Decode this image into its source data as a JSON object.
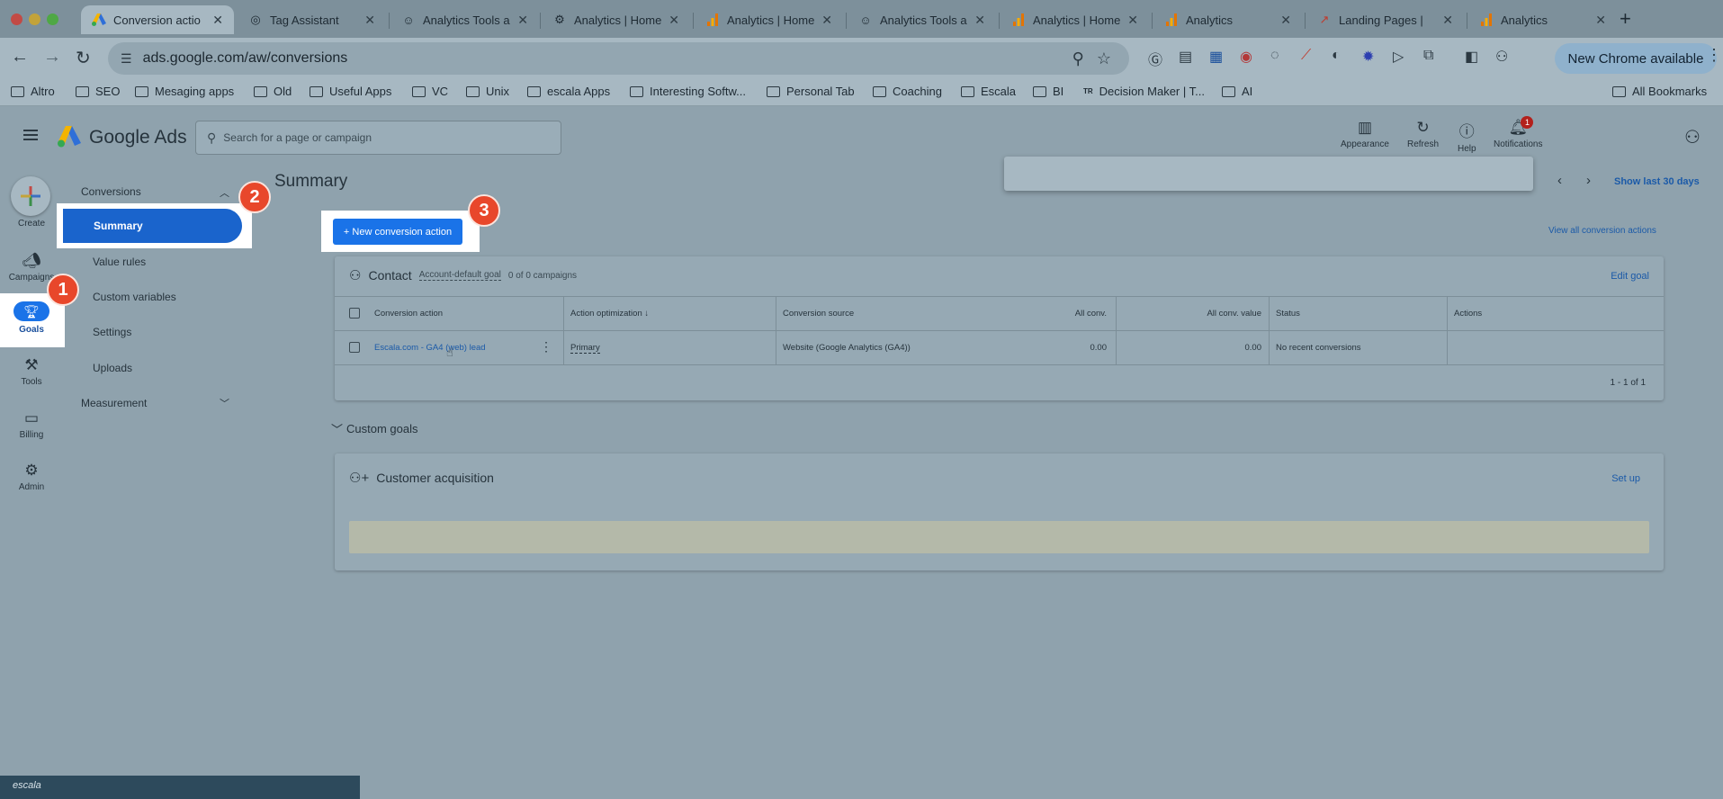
{
  "browser": {
    "tabs": [
      {
        "title": "Conversion actio",
        "icon": "google-ads-icon",
        "active": true
      },
      {
        "title": "Tag Assistant",
        "icon": "tag-assistant-icon"
      },
      {
        "title": "Analytics Tools a",
        "icon": "smiley-icon"
      },
      {
        "title": "Analytics | Home",
        "icon": "settings-gear-icon"
      },
      {
        "title": "Analytics | Home",
        "icon": "analytics-icon"
      },
      {
        "title": "Analytics Tools a",
        "icon": "smiley-icon"
      },
      {
        "title": "Analytics | Home",
        "icon": "analytics-icon"
      },
      {
        "title": "Analytics",
        "icon": "analytics-icon"
      },
      {
        "title": "Landing Pages |",
        "icon": "landing-pages-icon"
      },
      {
        "title": "Analytics",
        "icon": "analytics-icon"
      }
    ],
    "url": "ads.google.com/aw/conversions",
    "new_chrome_label": "New Chrome available",
    "bookmarks": [
      "Altro",
      "SEO",
      "Mesaging apps",
      "Old",
      "Useful Apps",
      "VC",
      "Unix",
      "escala Apps",
      "Interesting Softw...",
      "Personal Tab",
      "Coaching",
      "Escala",
      "BI",
      "Decision Maker | T...",
      "AI"
    ],
    "all_bookmarks_label": "All Bookmarks"
  },
  "ads": {
    "brand": "Google Ads",
    "search_placeholder": "Search for a page or campaign",
    "header_tools": [
      {
        "label": "Appearance",
        "icon": "appearance-icon"
      },
      {
        "label": "Refresh",
        "icon": "refresh-icon"
      },
      {
        "label": "Help",
        "icon": "help-icon"
      },
      {
        "label": "Notifications",
        "icon": "bell-icon",
        "badge": "1"
      }
    ],
    "rail": {
      "create": "Create",
      "campaigns": "Campaigns",
      "goals": "Goals",
      "tools": "Tools",
      "billing": "Billing",
      "admin": "Admin"
    },
    "subnav": {
      "conversions": "Conversions",
      "summary": "Summary",
      "value_rules": "Value rules",
      "custom_variables": "Custom variables",
      "settings": "Settings",
      "uploads": "Uploads",
      "measurement": "Measurement"
    },
    "callouts": [
      "1",
      "2",
      "3"
    ],
    "page_title": "Summary",
    "date_range_label": "Show last 30 days",
    "new_conversion_label": "+ New conversion action",
    "view_all_label": "View all conversion actions",
    "contact": {
      "title": "Contact",
      "goal_type": "Account-default goal",
      "campaigns": "0 of 0 campaigns",
      "edit_label": "Edit goal",
      "columns": [
        "Conversion action",
        "Action optimization",
        "Conversion source",
        "All conv.",
        "All conv. value",
        "Status",
        "Actions"
      ],
      "row": {
        "action": "Escala.com - GA4 (web) lead",
        "optimization": "Primary",
        "source": "Website (Google Analytics (GA4))",
        "all_conv": "0.00",
        "all_conv_value": "0.00",
        "status": "No recent conversions"
      },
      "pager": "1 - 1 of 1"
    },
    "custom_goals_label": "Custom goals",
    "customer_acq": {
      "title": "Customer acquisition",
      "setup_label": "Set up"
    }
  },
  "thumbnail_text": "escala",
  "colors": {
    "accent": "#1a73e8",
    "callout": "#e8472b",
    "link": "#1b5aa8"
  }
}
